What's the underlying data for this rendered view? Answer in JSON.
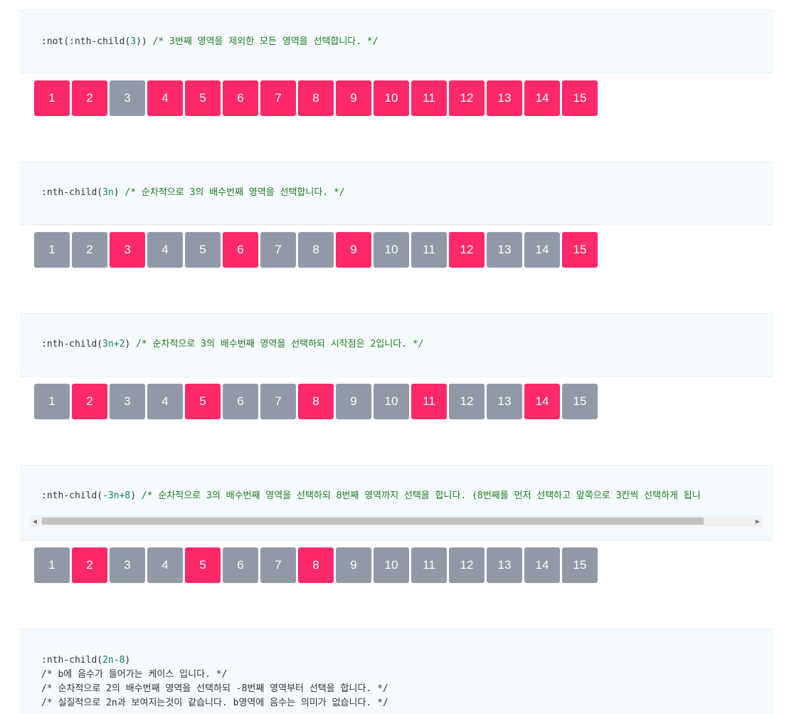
{
  "sections": [
    {
      "code": {
        "line1": {
          "prefix": ":not(:nth-child(",
          "num": "3",
          "suffix": ")) ",
          "comment": "/* 3번째 영역을 제외한 모든 영역을 선택합니다. */"
        }
      },
      "highlighted": [
        1,
        2,
        4,
        5,
        6,
        7,
        8,
        9,
        10,
        11,
        12,
        13,
        14,
        15
      ]
    },
    {
      "code": {
        "line1": {
          "prefix": ":nth-child(",
          "num": "3n",
          "suffix": ") ",
          "comment": "/* 순차적으로 3의 배수번째 영역을 선택합니다. */"
        }
      },
      "highlighted": [
        3,
        6,
        9,
        12,
        15
      ]
    },
    {
      "code": {
        "line1": {
          "prefix": ":nth-child(",
          "num": "3n+2",
          "suffix": ") ",
          "comment": "/* 순차적으로 3의 배수번째 영역을 선택하되 시작점은 2입니다. */"
        }
      },
      "highlighted": [
        2,
        5,
        8,
        11,
        14
      ]
    },
    {
      "code": {
        "line1": {
          "prefix": ":nth-child(",
          "num": "-3n+8",
          "suffix": ") ",
          "comment": "/* 순차적으로 3의 배수번째 영역을 선택하되 8번째 영역까지 선택을 합니다. (8번째를 먼저 선택하고 앞쪽으로 3칸씩 선택하게 됩니"
        }
      },
      "highlighted": [
        2,
        5,
        8
      ]
    },
    {
      "code": {
        "line1": {
          "prefix": ":nth-child(",
          "num": "2n-8",
          "suffix": ")",
          "comment": ""
        },
        "line2": "/* b에 음수가 들어가는 케이스 입니다. */",
        "line3": "/* 순차적으로 2의 배수번째 영역을 선택하되 -8번째 영역부터 선택을 합니다. */",
        "line4": "/* 실질적으로 2n과 보여지는것이 같습니다. b영역에 음수는 의미가 없습니다. */"
      }
    }
  ],
  "boxes": [
    "1",
    "2",
    "3",
    "4",
    "5",
    "6",
    "7",
    "8",
    "9",
    "10",
    "11",
    "12",
    "13",
    "14",
    "15"
  ],
  "scrollbar": {
    "left_arrow": "◀",
    "right_arrow": "▶"
  },
  "colors": {
    "selected": "#fe2968",
    "unselected": "#9198a6",
    "code_bg": "#f5fafe",
    "comment": "#1d7c1d",
    "number": "#098658"
  }
}
